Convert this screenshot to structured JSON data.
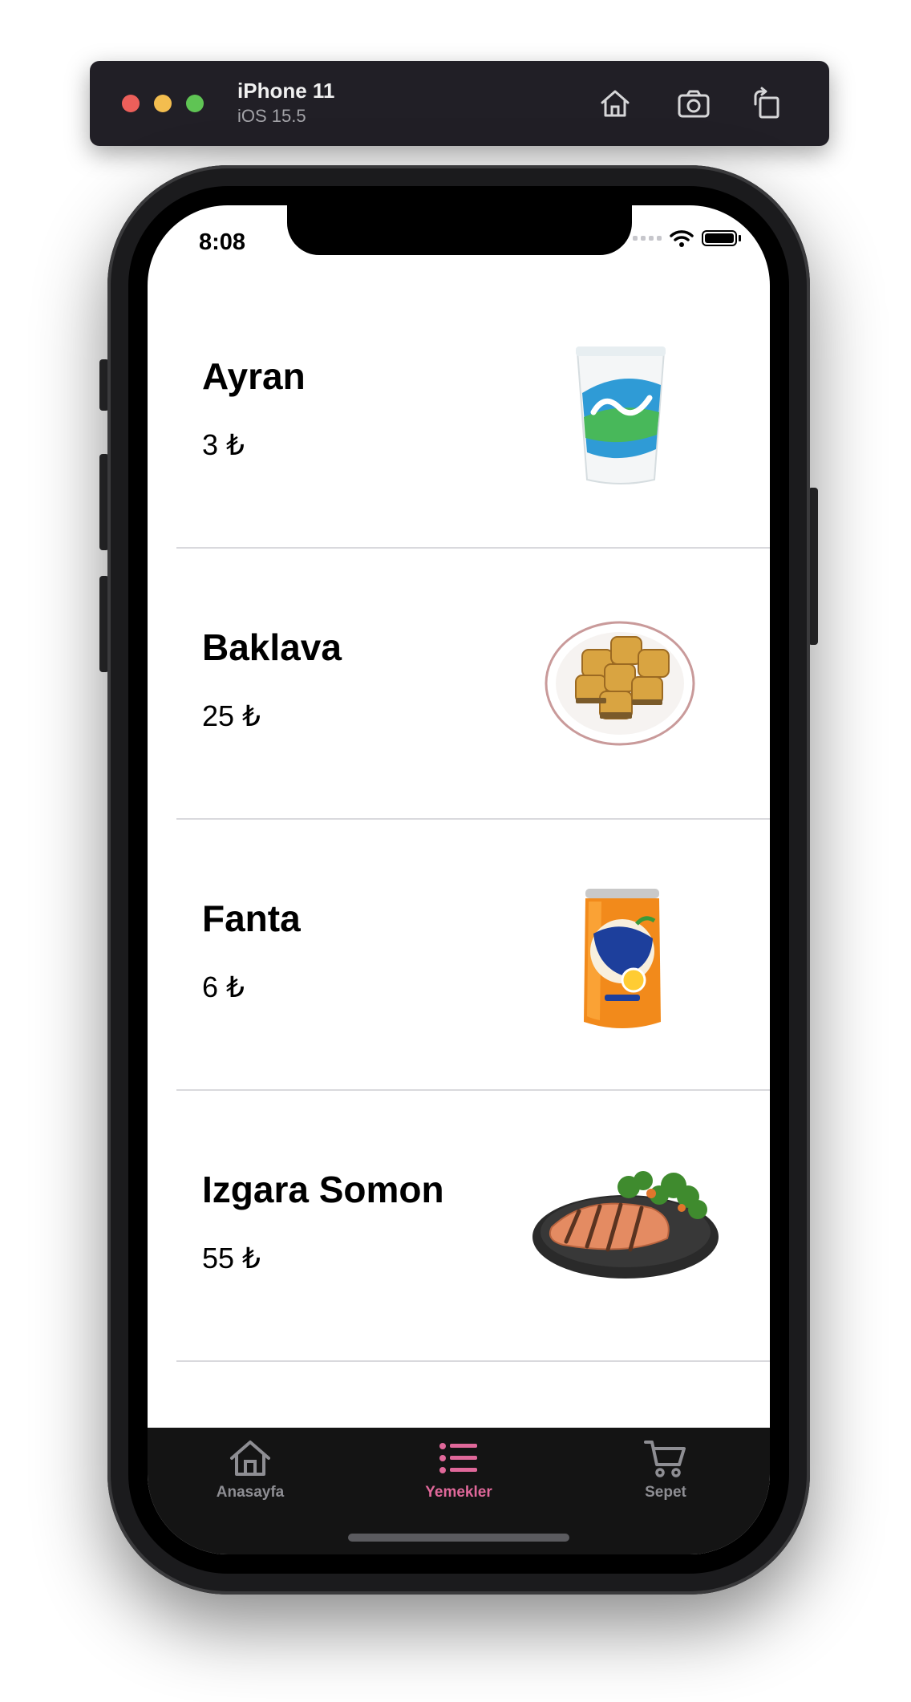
{
  "simulator": {
    "device_name": "iPhone 11",
    "os_version": "iOS 15.5",
    "icons": [
      "home-icon",
      "screenshot-icon",
      "rotate-icon"
    ]
  },
  "status_bar": {
    "time": "8:08",
    "icons": [
      "signal-icon",
      "wifi-icon",
      "battery-icon"
    ]
  },
  "menu": {
    "items": [
      {
        "name": "Ayran",
        "price": "3 ₺",
        "image": "ayran-cup-image"
      },
      {
        "name": "Baklava",
        "price": "25 ₺",
        "image": "baklava-plate-image"
      },
      {
        "name": "Fanta",
        "price": "6 ₺",
        "image": "fanta-can-image"
      },
      {
        "name": "Izgara Somon",
        "price": "55 ₺",
        "image": "grilled-salmon-image"
      }
    ]
  },
  "tab_bar": {
    "tabs": [
      {
        "label": "Anasayfa",
        "icon": "home-icon",
        "selected": false
      },
      {
        "label": "Yemekler",
        "icon": "list-icon",
        "selected": true
      },
      {
        "label": "Sepet",
        "icon": "cart-icon",
        "selected": false
      }
    ],
    "selected_color": "#e0689a",
    "unselected_color": "#8e8e93"
  }
}
